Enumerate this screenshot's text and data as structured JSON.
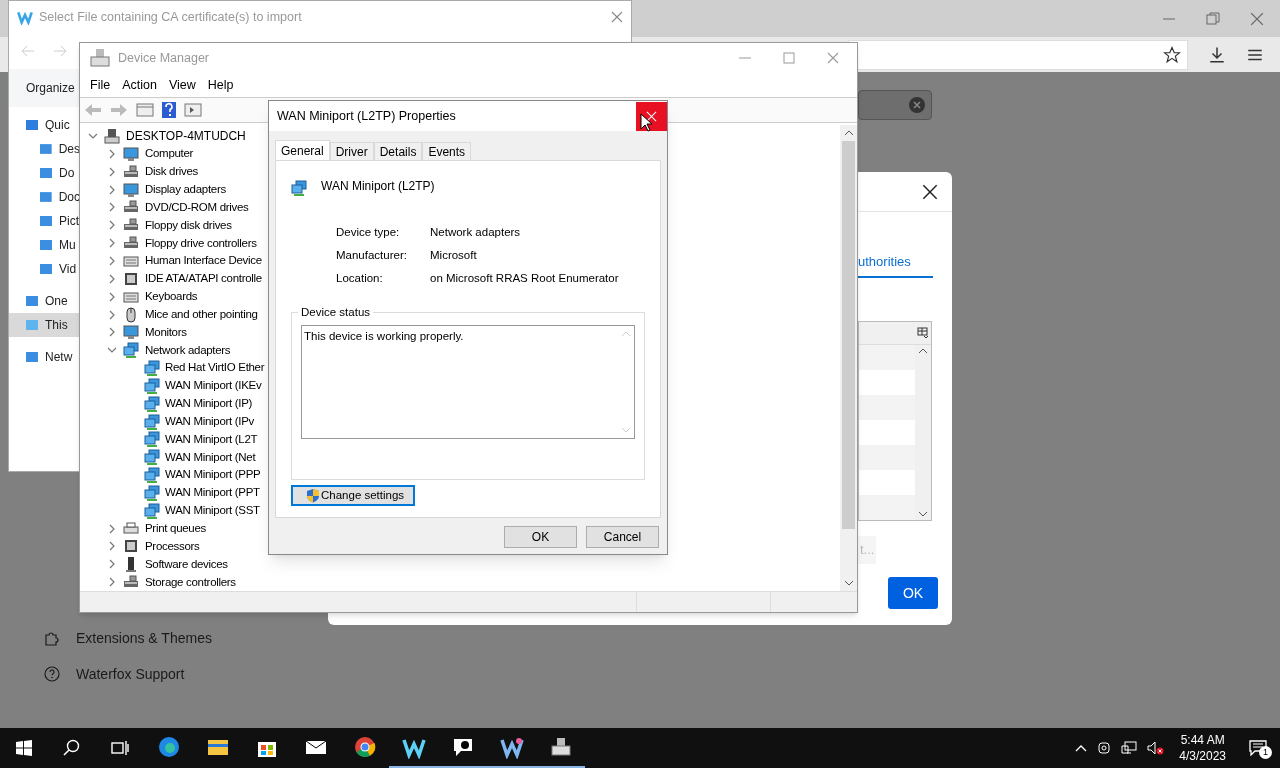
{
  "browser": {
    "menu_items": [
      {
        "label": "Extensions & Themes"
      },
      {
        "label": "Waterfox Support"
      }
    ]
  },
  "file_dialog": {
    "title": "Select File containing CA certificate(s) to import",
    "organize": "Organize",
    "nav": [
      {
        "label": "Quic",
        "selected": false
      },
      {
        "label": "Des",
        "selected": false
      },
      {
        "label": "Do",
        "selected": false
      },
      {
        "label": "Doc",
        "selected": false
      },
      {
        "label": "Pict",
        "selected": false
      },
      {
        "label": "Mu",
        "selected": false
      },
      {
        "label": "Vid",
        "selected": false
      },
      {
        "label": "One",
        "selected": false
      },
      {
        "label": "This",
        "selected": true
      },
      {
        "label": "Netw",
        "selected": false
      }
    ]
  },
  "certificate_dialog": {
    "tab": {
      "label": "uthorities",
      "selected": true
    },
    "button_partial": "t...",
    "ok": "OK"
  },
  "device_manager": {
    "title": "Device Manager",
    "menu": [
      "File",
      "Action",
      "View",
      "Help"
    ],
    "tree": {
      "label": "DESKTOP-4MTUDCH",
      "expanded": true,
      "children": [
        {
          "label": "Computer",
          "expanded": false
        },
        {
          "label": "Disk drives",
          "expanded": false
        },
        {
          "label": "Display adapters",
          "expanded": false
        },
        {
          "label": "DVD/CD-ROM drives",
          "expanded": false
        },
        {
          "label": "Floppy disk drives",
          "expanded": false
        },
        {
          "label": "Floppy drive controllers",
          "expanded": false
        },
        {
          "label": "Human Interface Device",
          "expanded": false
        },
        {
          "label": "IDE ATA/ATAPI controlle",
          "expanded": false
        },
        {
          "label": "Keyboards",
          "expanded": false
        },
        {
          "label": "Mice and other pointing",
          "expanded": false
        },
        {
          "label": "Monitors",
          "expanded": false
        },
        {
          "label": "Network adapters",
          "expanded": true,
          "children": [
            {
              "label": "Red Hat VirtIO Ether"
            },
            {
              "label": "WAN Miniport (IKEv"
            },
            {
              "label": "WAN Miniport (IP)"
            },
            {
              "label": "WAN Miniport (IPv"
            },
            {
              "label": "WAN Miniport (L2T"
            },
            {
              "label": "WAN Miniport (Net"
            },
            {
              "label": "WAN Miniport (PPP"
            },
            {
              "label": "WAN Miniport (PPT"
            },
            {
              "label": "WAN Miniport (SST"
            }
          ]
        },
        {
          "label": "Print queues",
          "expanded": false
        },
        {
          "label": "Processors",
          "expanded": false
        },
        {
          "label": "Software devices",
          "expanded": false
        },
        {
          "label": "Storage controllers",
          "expanded": false
        }
      ]
    }
  },
  "properties_dialog": {
    "title": "WAN Miniport (L2TP) Properties",
    "tabs": [
      {
        "label": "General",
        "selected": true
      },
      {
        "label": "Driver",
        "selected": false
      },
      {
        "label": "Details",
        "selected": false
      },
      {
        "label": "Events",
        "selected": false
      }
    ],
    "device_name": "WAN Miniport (L2TP)",
    "fields": [
      {
        "label": "Device type:",
        "value": "Network adapters"
      },
      {
        "label": "Manufacturer:",
        "value": "Microsoft"
      },
      {
        "label": "Location:",
        "value": "on Microsoft RRAS Root Enumerator"
      }
    ],
    "status_group": "Device status",
    "status_text": "This device is working properly.",
    "change_settings": "Change settings",
    "ok": "OK",
    "cancel": "Cancel"
  },
  "taskbar": {
    "apps": [
      {
        "running": false
      },
      {
        "running": false
      },
      {
        "running": false
      },
      {
        "running": false
      },
      {
        "running": false
      },
      {
        "running": true
      },
      {
        "running": true
      },
      {
        "running": true
      },
      {
        "running": true
      }
    ],
    "time": "5:44 AM",
    "date": "4/3/2023",
    "notifications": "1"
  }
}
